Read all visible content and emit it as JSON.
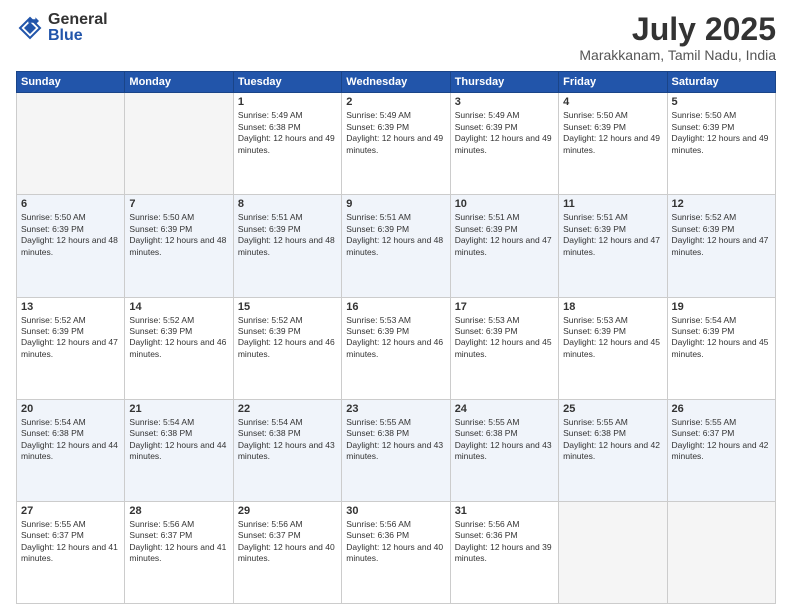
{
  "logo": {
    "general": "General",
    "blue": "Blue"
  },
  "title": "July 2025",
  "subtitle": "Marakkanam, Tamil Nadu, India",
  "days_of_week": [
    "Sunday",
    "Monday",
    "Tuesday",
    "Wednesday",
    "Thursday",
    "Friday",
    "Saturday"
  ],
  "weeks": [
    [
      {
        "day": "",
        "info": ""
      },
      {
        "day": "",
        "info": ""
      },
      {
        "day": "1",
        "info": "Sunrise: 5:49 AM\nSunset: 6:38 PM\nDaylight: 12 hours and 49 minutes."
      },
      {
        "day": "2",
        "info": "Sunrise: 5:49 AM\nSunset: 6:39 PM\nDaylight: 12 hours and 49 minutes."
      },
      {
        "day": "3",
        "info": "Sunrise: 5:49 AM\nSunset: 6:39 PM\nDaylight: 12 hours and 49 minutes."
      },
      {
        "day": "4",
        "info": "Sunrise: 5:50 AM\nSunset: 6:39 PM\nDaylight: 12 hours and 49 minutes."
      },
      {
        "day": "5",
        "info": "Sunrise: 5:50 AM\nSunset: 6:39 PM\nDaylight: 12 hours and 49 minutes."
      }
    ],
    [
      {
        "day": "6",
        "info": "Sunrise: 5:50 AM\nSunset: 6:39 PM\nDaylight: 12 hours and 48 minutes."
      },
      {
        "day": "7",
        "info": "Sunrise: 5:50 AM\nSunset: 6:39 PM\nDaylight: 12 hours and 48 minutes."
      },
      {
        "day": "8",
        "info": "Sunrise: 5:51 AM\nSunset: 6:39 PM\nDaylight: 12 hours and 48 minutes."
      },
      {
        "day": "9",
        "info": "Sunrise: 5:51 AM\nSunset: 6:39 PM\nDaylight: 12 hours and 48 minutes."
      },
      {
        "day": "10",
        "info": "Sunrise: 5:51 AM\nSunset: 6:39 PM\nDaylight: 12 hours and 47 minutes."
      },
      {
        "day": "11",
        "info": "Sunrise: 5:51 AM\nSunset: 6:39 PM\nDaylight: 12 hours and 47 minutes."
      },
      {
        "day": "12",
        "info": "Sunrise: 5:52 AM\nSunset: 6:39 PM\nDaylight: 12 hours and 47 minutes."
      }
    ],
    [
      {
        "day": "13",
        "info": "Sunrise: 5:52 AM\nSunset: 6:39 PM\nDaylight: 12 hours and 47 minutes."
      },
      {
        "day": "14",
        "info": "Sunrise: 5:52 AM\nSunset: 6:39 PM\nDaylight: 12 hours and 46 minutes."
      },
      {
        "day": "15",
        "info": "Sunrise: 5:52 AM\nSunset: 6:39 PM\nDaylight: 12 hours and 46 minutes."
      },
      {
        "day": "16",
        "info": "Sunrise: 5:53 AM\nSunset: 6:39 PM\nDaylight: 12 hours and 46 minutes."
      },
      {
        "day": "17",
        "info": "Sunrise: 5:53 AM\nSunset: 6:39 PM\nDaylight: 12 hours and 45 minutes."
      },
      {
        "day": "18",
        "info": "Sunrise: 5:53 AM\nSunset: 6:39 PM\nDaylight: 12 hours and 45 minutes."
      },
      {
        "day": "19",
        "info": "Sunrise: 5:54 AM\nSunset: 6:39 PM\nDaylight: 12 hours and 45 minutes."
      }
    ],
    [
      {
        "day": "20",
        "info": "Sunrise: 5:54 AM\nSunset: 6:38 PM\nDaylight: 12 hours and 44 minutes."
      },
      {
        "day": "21",
        "info": "Sunrise: 5:54 AM\nSunset: 6:38 PM\nDaylight: 12 hours and 44 minutes."
      },
      {
        "day": "22",
        "info": "Sunrise: 5:54 AM\nSunset: 6:38 PM\nDaylight: 12 hours and 43 minutes."
      },
      {
        "day": "23",
        "info": "Sunrise: 5:55 AM\nSunset: 6:38 PM\nDaylight: 12 hours and 43 minutes."
      },
      {
        "day": "24",
        "info": "Sunrise: 5:55 AM\nSunset: 6:38 PM\nDaylight: 12 hours and 43 minutes."
      },
      {
        "day": "25",
        "info": "Sunrise: 5:55 AM\nSunset: 6:38 PM\nDaylight: 12 hours and 42 minutes."
      },
      {
        "day": "26",
        "info": "Sunrise: 5:55 AM\nSunset: 6:37 PM\nDaylight: 12 hours and 42 minutes."
      }
    ],
    [
      {
        "day": "27",
        "info": "Sunrise: 5:55 AM\nSunset: 6:37 PM\nDaylight: 12 hours and 41 minutes."
      },
      {
        "day": "28",
        "info": "Sunrise: 5:56 AM\nSunset: 6:37 PM\nDaylight: 12 hours and 41 minutes."
      },
      {
        "day": "29",
        "info": "Sunrise: 5:56 AM\nSunset: 6:37 PM\nDaylight: 12 hours and 40 minutes."
      },
      {
        "day": "30",
        "info": "Sunrise: 5:56 AM\nSunset: 6:36 PM\nDaylight: 12 hours and 40 minutes."
      },
      {
        "day": "31",
        "info": "Sunrise: 5:56 AM\nSunset: 6:36 PM\nDaylight: 12 hours and 39 minutes."
      },
      {
        "day": "",
        "info": ""
      },
      {
        "day": "",
        "info": ""
      }
    ]
  ]
}
